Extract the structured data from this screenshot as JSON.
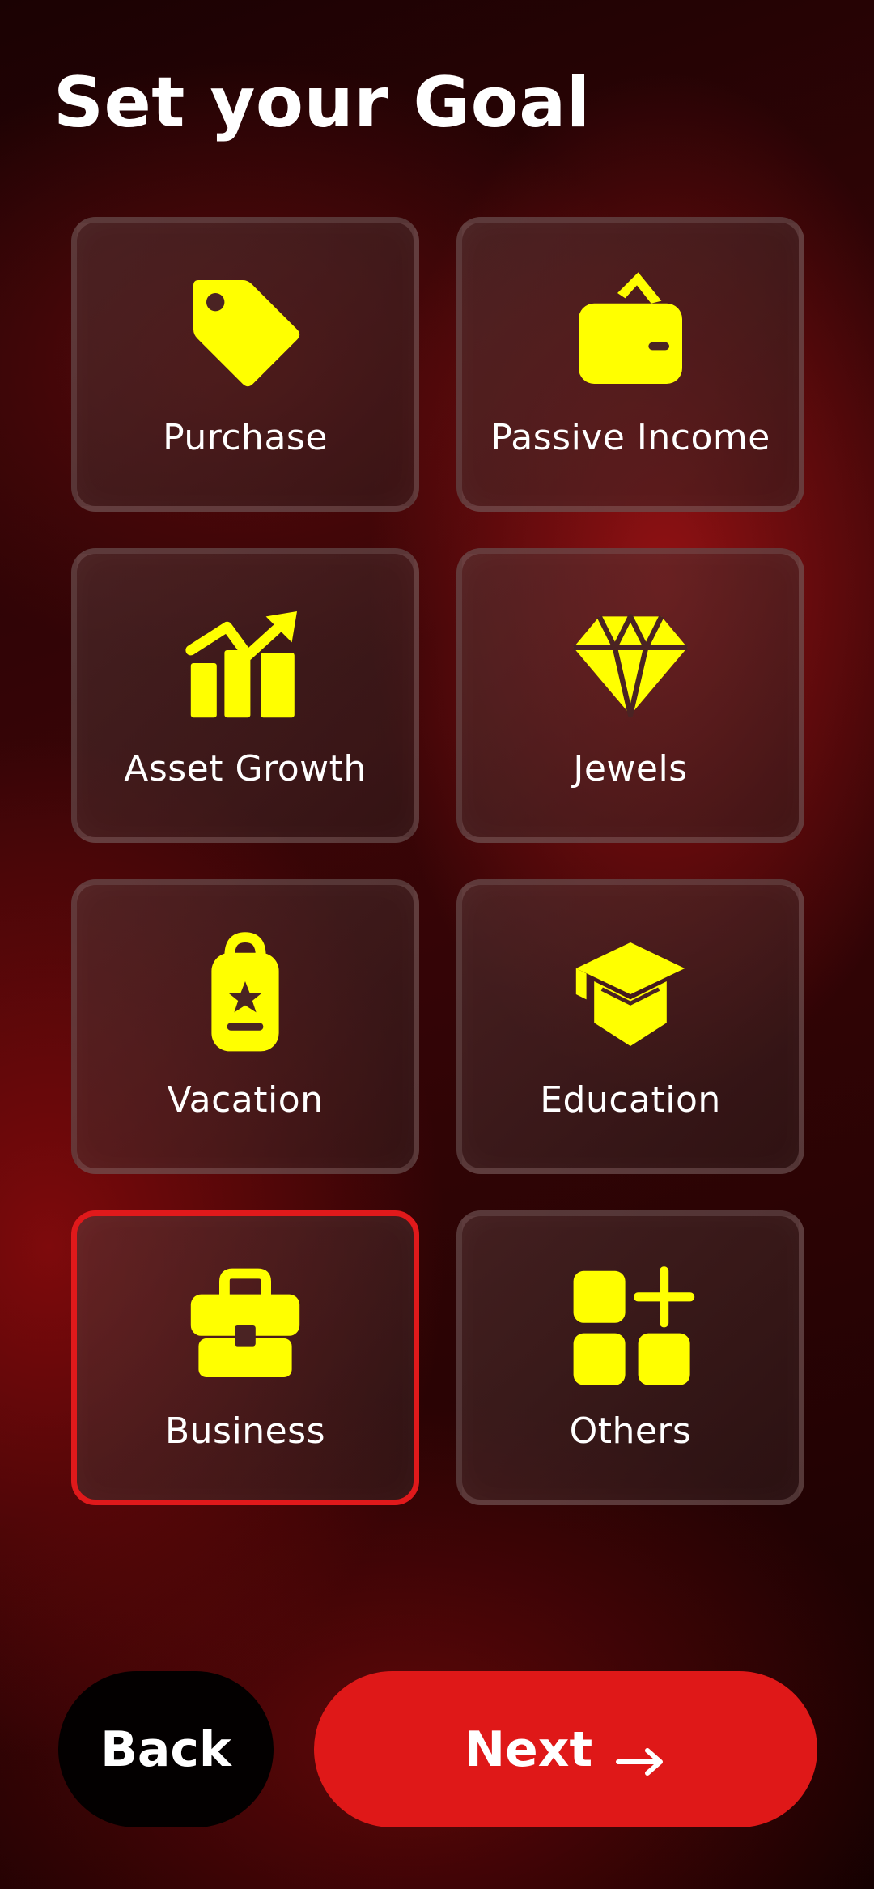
{
  "page": {
    "title": "Set your Goal"
  },
  "colors": {
    "accent": "#df1818",
    "icon": "#ffff00",
    "selected_border": "#e0191b"
  },
  "goals": [
    {
      "label": "Purchase",
      "icon": "tag-icon",
      "selected": false
    },
    {
      "label": "Passive Income",
      "icon": "wallet-icon",
      "selected": false
    },
    {
      "label": "Asset Growth",
      "icon": "growth-chart-icon",
      "selected": false
    },
    {
      "label": "Jewels",
      "icon": "diamond-icon",
      "selected": false
    },
    {
      "label": "Vacation",
      "icon": "backpack-icon",
      "selected": false
    },
    {
      "label": "Education",
      "icon": "graduation-cap-icon",
      "selected": false
    },
    {
      "label": "Business",
      "icon": "briefcase-icon",
      "selected": true
    },
    {
      "label": "Others",
      "icon": "apps-plus-icon",
      "selected": false
    }
  ],
  "footer": {
    "back_label": "Back",
    "next_label": "Next",
    "next_icon": "arrow-right-icon"
  }
}
